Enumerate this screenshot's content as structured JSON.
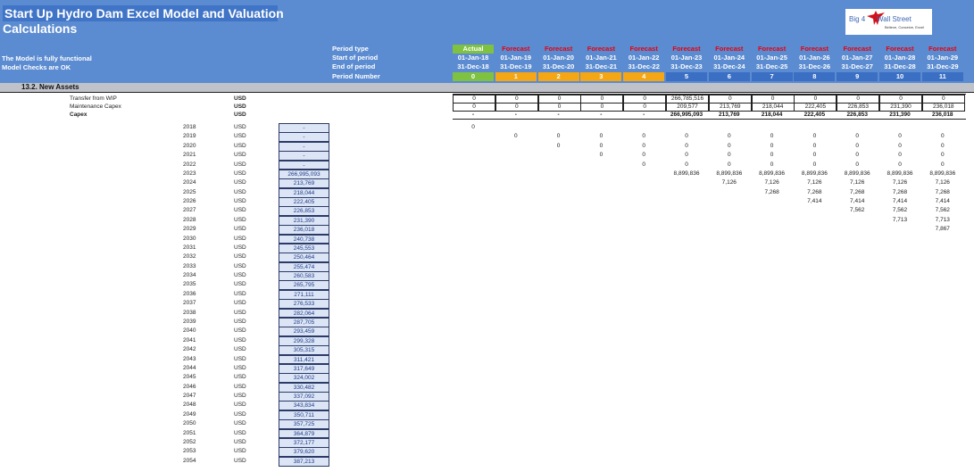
{
  "header": {
    "title": "Start Up Hydro Dam Excel Model and Valuation",
    "subtitle": "Calculations",
    "status_line1": "The Model is fully functional",
    "status_line2": "Model Checks are OK",
    "logo_text_left": "Big 4",
    "logo_text_right": "Wall Street",
    "logo_tagline": "Believe, Conceive, Excel",
    "row_labels": [
      "Period type",
      "Start of period",
      "End of period",
      "Period Number"
    ]
  },
  "periods": [
    {
      "type": "Actual",
      "start": "01-Jan-18",
      "end": "31-Dec-18",
      "num": "0",
      "color": "#7fc241"
    },
    {
      "type": "Forecast",
      "start": "01-Jan-19",
      "end": "31-Dec-19",
      "num": "1",
      "color": "#f5a614"
    },
    {
      "type": "Forecast",
      "start": "01-Jan-20",
      "end": "31-Dec-20",
      "num": "2",
      "color": "#f5a614"
    },
    {
      "type": "Forecast",
      "start": "01-Jan-21",
      "end": "31-Dec-21",
      "num": "3",
      "color": "#f5a614"
    },
    {
      "type": "Forecast",
      "start": "01-Jan-22",
      "end": "31-Dec-22",
      "num": "4",
      "color": "#f5a614"
    },
    {
      "type": "Forecast",
      "start": "01-Jan-23",
      "end": "31-Dec-23",
      "num": "5",
      "color": "#3a6fc4"
    },
    {
      "type": "Forecast",
      "start": "01-Jan-24",
      "end": "31-Dec-24",
      "num": "6",
      "color": "#3a6fc4"
    },
    {
      "type": "Forecast",
      "start": "01-Jan-25",
      "end": "31-Dec-25",
      "num": "7",
      "color": "#3a6fc4"
    },
    {
      "type": "Forecast",
      "start": "01-Jan-26",
      "end": "31-Dec-26",
      "num": "8",
      "color": "#3a6fc4"
    },
    {
      "type": "Forecast",
      "start": "01-Jan-27",
      "end": "31-Dec-27",
      "num": "9",
      "color": "#3a6fc4"
    },
    {
      "type": "Forecast",
      "start": "01-Jan-28",
      "end": "31-Dec-28",
      "num": "10",
      "color": "#3a6fc4"
    },
    {
      "type": "Forecast",
      "start": "01-Jan-29",
      "end": "31-Dec-29",
      "num": "11",
      "color": "#3a6fc4"
    }
  ],
  "colors": {
    "forecast_text": "#e8000b",
    "actual_bg": "#7fc241",
    "banner": "#5b8bd0"
  },
  "section": {
    "label": "13.2.  New Assets"
  },
  "summary_rows": [
    {
      "label": "Transfer from WIP",
      "unit": "USD",
      "bold": false,
      "values": [
        "0",
        "0",
        "0",
        "0",
        "0",
        "266,785,516",
        "0",
        "0",
        "0",
        "0",
        "0",
        "0"
      ]
    },
    {
      "label": "Maintenance Capex",
      "unit": "USD",
      "bold": false,
      "values": [
        "0",
        "0",
        "0",
        "0",
        "0",
        "209,577",
        "213,769",
        "218,044",
        "222,405",
        "226,853",
        "231,390",
        "236,018"
      ]
    },
    {
      "label": "Capex",
      "unit": "USD",
      "bold": true,
      "values": [
        "-",
        "-",
        "-",
        "-",
        "-",
        "266,995,093",
        "213,769",
        "218,044",
        "222,405",
        "226,853",
        "231,390",
        "236,018"
      ]
    }
  ],
  "years": [
    {
      "year": "2018",
      "unit": "USD",
      "capex": "-",
      "cells": [
        "0",
        "",
        "",
        "",
        "",
        "",
        "",
        "",
        "",
        "",
        "",
        ""
      ]
    },
    {
      "year": "2019",
      "unit": "USD",
      "capex": "-",
      "cells": [
        "",
        "0",
        "0",
        "0",
        "0",
        "0",
        "0",
        "0",
        "0",
        "0",
        "0",
        "0"
      ]
    },
    {
      "year": "2020",
      "unit": "USD",
      "capex": "-",
      "cells": [
        "",
        "",
        "0",
        "0",
        "0",
        "0",
        "0",
        "0",
        "0",
        "0",
        "0",
        "0"
      ]
    },
    {
      "year": "2021",
      "unit": "USD",
      "capex": "-",
      "cells": [
        "",
        "",
        "",
        "0",
        "0",
        "0",
        "0",
        "0",
        "0",
        "0",
        "0",
        "0"
      ]
    },
    {
      "year": "2022",
      "unit": "USD",
      "capex": "-",
      "cells": [
        "",
        "",
        "",
        "",
        "0",
        "0",
        "0",
        "0",
        "0",
        "0",
        "0",
        "0"
      ]
    },
    {
      "year": "2023",
      "unit": "USD",
      "capex": "266,995,093",
      "cells": [
        "",
        "",
        "",
        "",
        "",
        "8,899,836",
        "8,899,836",
        "8,899,836",
        "8,899,836",
        "8,899,836",
        "8,899,836",
        "8,899,836"
      ]
    },
    {
      "year": "2024",
      "unit": "USD",
      "capex": "213,769",
      "cells": [
        "",
        "",
        "",
        "",
        "",
        "",
        "7,126",
        "7,126",
        "7,126",
        "7,126",
        "7,126",
        "7,126"
      ]
    },
    {
      "year": "2025",
      "unit": "USD",
      "capex": "218,044",
      "cells": [
        "",
        "",
        "",
        "",
        "",
        "",
        "",
        "7,268",
        "7,268",
        "7,268",
        "7,268",
        "7,268"
      ]
    },
    {
      "year": "2026",
      "unit": "USD",
      "capex": "222,405",
      "cells": [
        "",
        "",
        "",
        "",
        "",
        "",
        "",
        "",
        "7,414",
        "7,414",
        "7,414",
        "7,414"
      ]
    },
    {
      "year": "2027",
      "unit": "USD",
      "capex": "226,853",
      "cells": [
        "",
        "",
        "",
        "",
        "",
        "",
        "",
        "",
        "",
        "7,562",
        "7,562",
        "7,562"
      ]
    },
    {
      "year": "2028",
      "unit": "USD",
      "capex": "231,390",
      "cells": [
        "",
        "",
        "",
        "",
        "",
        "",
        "",
        "",
        "",
        "",
        "7,713",
        "7,713"
      ]
    },
    {
      "year": "2029",
      "unit": "USD",
      "capex": "236,018",
      "cells": [
        "",
        "",
        "",
        "",
        "",
        "",
        "",
        "",
        "",
        "",
        "",
        "7,867"
      ]
    },
    {
      "year": "2030",
      "unit": "USD",
      "capex": "240,738",
      "cells": []
    },
    {
      "year": "2031",
      "unit": "USD",
      "capex": "245,553",
      "cells": []
    },
    {
      "year": "2032",
      "unit": "USD",
      "capex": "250,464",
      "cells": []
    },
    {
      "year": "2033",
      "unit": "USD",
      "capex": "255,474",
      "cells": []
    },
    {
      "year": "2034",
      "unit": "USD",
      "capex": "260,583",
      "cells": []
    },
    {
      "year": "2035",
      "unit": "USD",
      "capex": "265,795",
      "cells": []
    },
    {
      "year": "2036",
      "unit": "USD",
      "capex": "271,111",
      "cells": []
    },
    {
      "year": "2037",
      "unit": "USD",
      "capex": "276,533",
      "cells": []
    },
    {
      "year": "2038",
      "unit": "USD",
      "capex": "282,064",
      "cells": []
    },
    {
      "year": "2039",
      "unit": "USD",
      "capex": "287,705",
      "cells": []
    },
    {
      "year": "2040",
      "unit": "USD",
      "capex": "293,459",
      "cells": []
    },
    {
      "year": "2041",
      "unit": "USD",
      "capex": "299,328",
      "cells": []
    },
    {
      "year": "2042",
      "unit": "USD",
      "capex": "305,315",
      "cells": []
    },
    {
      "year": "2043",
      "unit": "USD",
      "capex": "311,421",
      "cells": []
    },
    {
      "year": "2044",
      "unit": "USD",
      "capex": "317,649",
      "cells": []
    },
    {
      "year": "2045",
      "unit": "USD",
      "capex": "324,002",
      "cells": []
    },
    {
      "year": "2046",
      "unit": "USD",
      "capex": "330,482",
      "cells": []
    },
    {
      "year": "2047",
      "unit": "USD",
      "capex": "337,092",
      "cells": []
    },
    {
      "year": "2048",
      "unit": "USD",
      "capex": "343,834",
      "cells": []
    },
    {
      "year": "2049",
      "unit": "USD",
      "capex": "350,711",
      "cells": []
    },
    {
      "year": "2050",
      "unit": "USD",
      "capex": "357,725",
      "cells": []
    },
    {
      "year": "2051",
      "unit": "USD",
      "capex": "364,879",
      "cells": []
    },
    {
      "year": "2052",
      "unit": "USD",
      "capex": "372,177",
      "cells": []
    },
    {
      "year": "2053",
      "unit": "USD",
      "capex": "379,620",
      "cells": []
    },
    {
      "year": "2054",
      "unit": "USD",
      "capex": "387,213",
      "cells": []
    }
  ]
}
